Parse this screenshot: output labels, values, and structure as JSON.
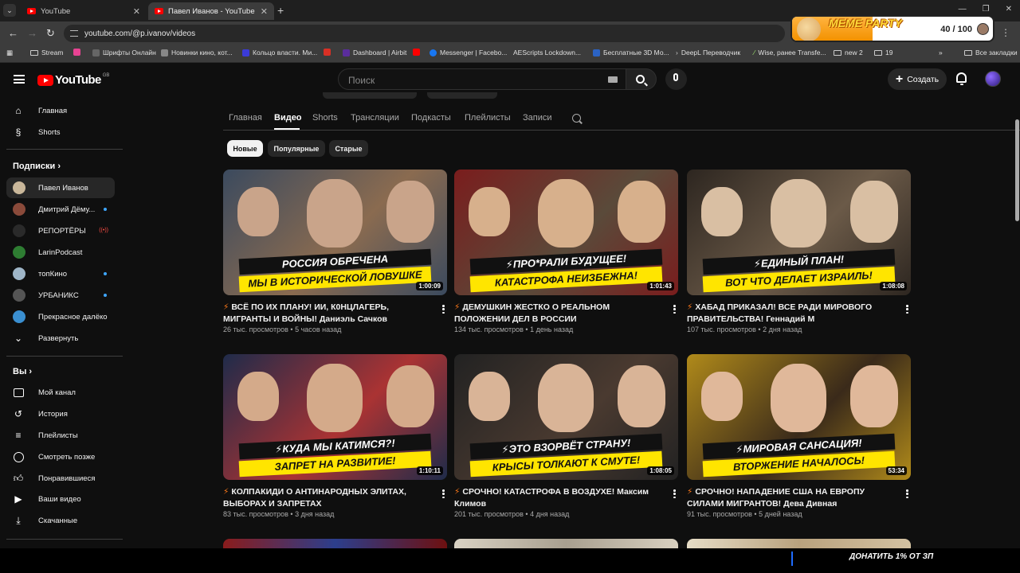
{
  "browser": {
    "tabs": [
      {
        "title": "YouTube"
      },
      {
        "title": "Павел Иванов - YouTube"
      }
    ],
    "url": "youtube.com/@p.ivanov/videos",
    "bookmarks": [
      "Stream",
      "Шрифты Онлайн",
      "Новинки кино, кот...",
      "Кольцо власти. Ми...",
      "Dashboard | Airbit",
      "Messenger | Facebo...",
      "AEScripts Lockdown...",
      "Бесплатные 3D Мо...",
      "DeepL Переводчик",
      "Wise, ранее Transfe...",
      "new 2",
      "19",
      "Все закладки"
    ]
  },
  "overlay": {
    "title": "MEME PARTY",
    "score": "40 / 100",
    "progress": 0.4,
    "donate": "ДОНАТИТЬ 1% ОТ ЗП"
  },
  "header": {
    "logo": "YouTube",
    "region": "GB",
    "search_placeholder": "Поиск",
    "create_label": "Создать"
  },
  "sidebar": {
    "main": [
      {
        "label": "Главная",
        "icon": "home-icon"
      },
      {
        "label": "Shorts",
        "icon": "shorts-icon"
      }
    ],
    "subscriptions_heading": "Подписки",
    "subscriptions": [
      {
        "label": "Павел Иванов",
        "color": "#c9b79a"
      },
      {
        "label": "Дмитрий Дёму...",
        "color": "#8a4a3a"
      },
      {
        "label": "РЕПОРТЁРЫ",
        "color": "#2a2a2a"
      },
      {
        "label": "LarinPodcast",
        "color": "#2e7d32"
      },
      {
        "label": "топКино",
        "color": "#9fb6c8"
      },
      {
        "label": "УРБАНИКС",
        "color": "#555555"
      },
      {
        "label": "Прекрасное далёко",
        "color": "#3a8fd1"
      },
      {
        "label": "Развернуть"
      }
    ],
    "you_heading": "Вы",
    "you": [
      {
        "label": "Мой канал",
        "icon": "channel-icon"
      },
      {
        "label": "История",
        "icon": "history-icon"
      },
      {
        "label": "Плейлисты",
        "icon": "playlists-icon"
      },
      {
        "label": "Смотреть позже",
        "icon": "watch-later-icon"
      },
      {
        "label": "Понравившиеся",
        "icon": "like-icon"
      },
      {
        "label": "Ваши видео",
        "icon": "your-videos-icon"
      },
      {
        "label": "Скачанные",
        "icon": "download-icon"
      }
    ]
  },
  "channel_tabs": [
    "Главная",
    "Видео",
    "Shorts",
    "Трансляции",
    "Подкасты",
    "Плейлисты",
    "Записи"
  ],
  "chips": [
    "Новые",
    "Популярные",
    "Старые"
  ],
  "videos": [
    {
      "caption1": "РОССИЯ ОБРЕЧЕНА",
      "caption2": "МЫ В ИСТОРИЧЕСКОЙ ЛОВУШКЕ",
      "duration": "1:00:09",
      "title": "ВСЁ ПО ИХ ПЛАНУ! ИИ, К0НЦЛАГЕРЬ, МИГРАНТЫ И ВОЙНЫ! Даниэль Сачков",
      "views": "26 тыс. просмотров",
      "age": "5 часов назад"
    },
    {
      "caption1": "⚡ПРО*РАЛИ БУДУЩЕЕ!",
      "caption2": "КАТАСТРОФА НЕИЗБЕЖНА!",
      "duration": "1:01:43",
      "title": "ДЕМУШКИН ЖЕСТКО О РЕАЛЬНОМ ПОЛОЖЕНИИ ДЕЛ В РОССИИ",
      "views": "134 тыс. просмотров",
      "age": "1 день назад"
    },
    {
      "caption1": "⚡ЕДИНЫЙ ПЛАН!",
      "caption2": "ВОТ ЧТО ДЕЛАЕТ ИЗРАИЛЬ!",
      "duration": "1:08:08",
      "title": "ХАБАД ПРИКАЗАЛ! ВСЕ РАДИ МИРОВОГО ПРАВИТЕЛЬСТВА! Геннадий М",
      "views": "107 тыс. просмотров",
      "age": "2 дня назад"
    },
    {
      "caption1": "⚡КУДА МЫ КАТИМСЯ?!",
      "caption2": "ЗАПРЕТ НА РАЗВИТИЕ!",
      "duration": "1:10:11",
      "title": "КОЛПАКИДИ О АНТИНАРОДНЫХ ЭЛИТАХ, ВЫБОРАХ И ЗАПРЕТАХ",
      "views": "83 тыс. просмотров",
      "age": "3 дня назад"
    },
    {
      "caption1": "⚡ЭТО ВЗОРВЁТ СТРАНУ!",
      "caption2": "КРЫСЫ ТОЛКАЮТ К СМУТЕ!",
      "duration": "1:08:05",
      "title": "СРОЧНО! КАТАСТРОФА В ВОЗДУХЕ! Максим Климов",
      "views": "201 тыс. просмотров",
      "age": "4 дня назад"
    },
    {
      "caption1": "⚡МИРОВАЯ САНСАЦИЯ!",
      "caption2": "ВТОРЖЕНИЕ НАЧАЛОСЬ!",
      "duration": "53:34",
      "title": "СРОЧНО! НАПАДЕНИЕ США НА ЕВРОПУ СИЛАМИ МИГРАНТОВ! Дева Дивная",
      "views": "91 тыс. просмотров",
      "age": "5 дней назад"
    }
  ]
}
